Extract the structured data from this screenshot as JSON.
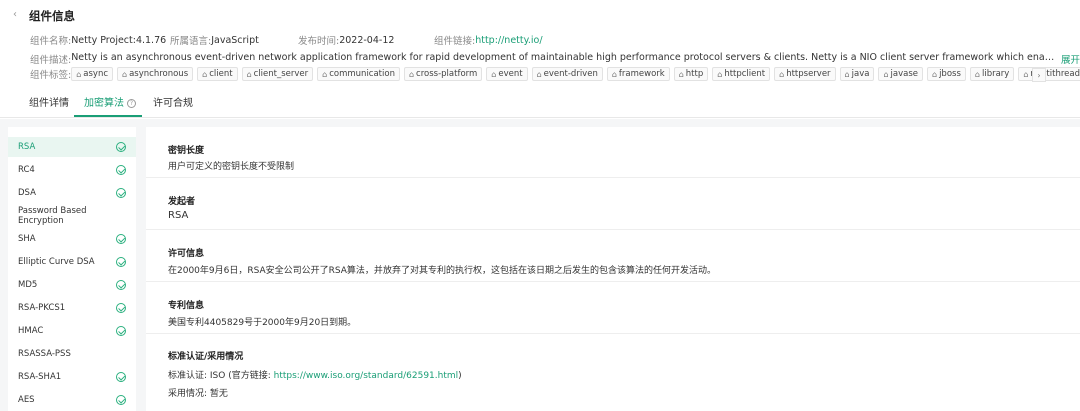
{
  "header": {
    "back_icon": "chevron-left-icon",
    "title": "组件信息"
  },
  "meta": {
    "name_label": "组件名称:",
    "name_value": "Netty Project:4.1.76",
    "lang_label": "所属语言:",
    "lang_value": "JavaScript",
    "date_label": "发布时间:",
    "date_value": "2022-04-12",
    "link_label": "组件链接:",
    "link_value": "http://netty.io/"
  },
  "description": {
    "label": "组件描述:",
    "text": "Netty is an asynchronous event-driven network application framework for rapid development of maintainable high performance protocol servers & clients.  Netty is a NIO client server framework which enables quick and easy ...",
    "expand_label": "展开"
  },
  "tags": {
    "label": "组件标签:",
    "items": [
      "async",
      "asynchronous",
      "client",
      "client_server",
      "communication",
      "cross-platform",
      "event",
      "event-driven",
      "framework",
      "http",
      "httpclient",
      "httpserver",
      "java",
      "javase",
      "jboss",
      "library",
      "multithreaded"
    ]
  },
  "tabs": [
    {
      "label": "组件详情"
    },
    {
      "label": "加密算法"
    },
    {
      "label": "许可合规"
    }
  ],
  "algorithms": [
    {
      "name": "RSA",
      "checked": true
    },
    {
      "name": "RC4",
      "checked": true
    },
    {
      "name": "DSA",
      "checked": true
    },
    {
      "name": "Password Based Encryption",
      "checked": false
    },
    {
      "name": "SHA",
      "checked": true
    },
    {
      "name": "Elliptic Curve DSA",
      "checked": true
    },
    {
      "name": "MD5",
      "checked": true
    },
    {
      "name": "RSA-PKCS1",
      "checked": true
    },
    {
      "name": "HMAC",
      "checked": true
    },
    {
      "name": "RSASSA-PSS",
      "checked": false
    },
    {
      "name": "RSA-SHA1",
      "checked": true
    },
    {
      "name": "AES",
      "checked": true
    }
  ],
  "detail": {
    "key_length": {
      "title": "密钥长度",
      "text": "用户可定义的密钥长度不受限制"
    },
    "initiator": {
      "title": "发起者",
      "text": "RSA"
    },
    "license": {
      "title": "许可信息",
      "text": "在2000年9月6日，RSA安全公司公开了RSA算法，并放弃了对其专利的执行权，这包括在该日期之后发生的包含该算法的任何开发活动。"
    },
    "patent": {
      "title": "专利信息",
      "text": "美国专利4405829号于2000年9月20日到期。"
    },
    "standard": {
      "title": "标准认证/采用情况",
      "cert_label": "标准认证:  ISO  (官方链接:",
      "cert_link": "https://www.iso.org/standard/62591.html",
      "cert_suffix": ")",
      "adoption": "采用情况: 暂无"
    }
  },
  "colors": {
    "accent": "#1a9e76",
    "active_bg": "#e9f6f1",
    "page_bg": "#f5f6f7"
  }
}
